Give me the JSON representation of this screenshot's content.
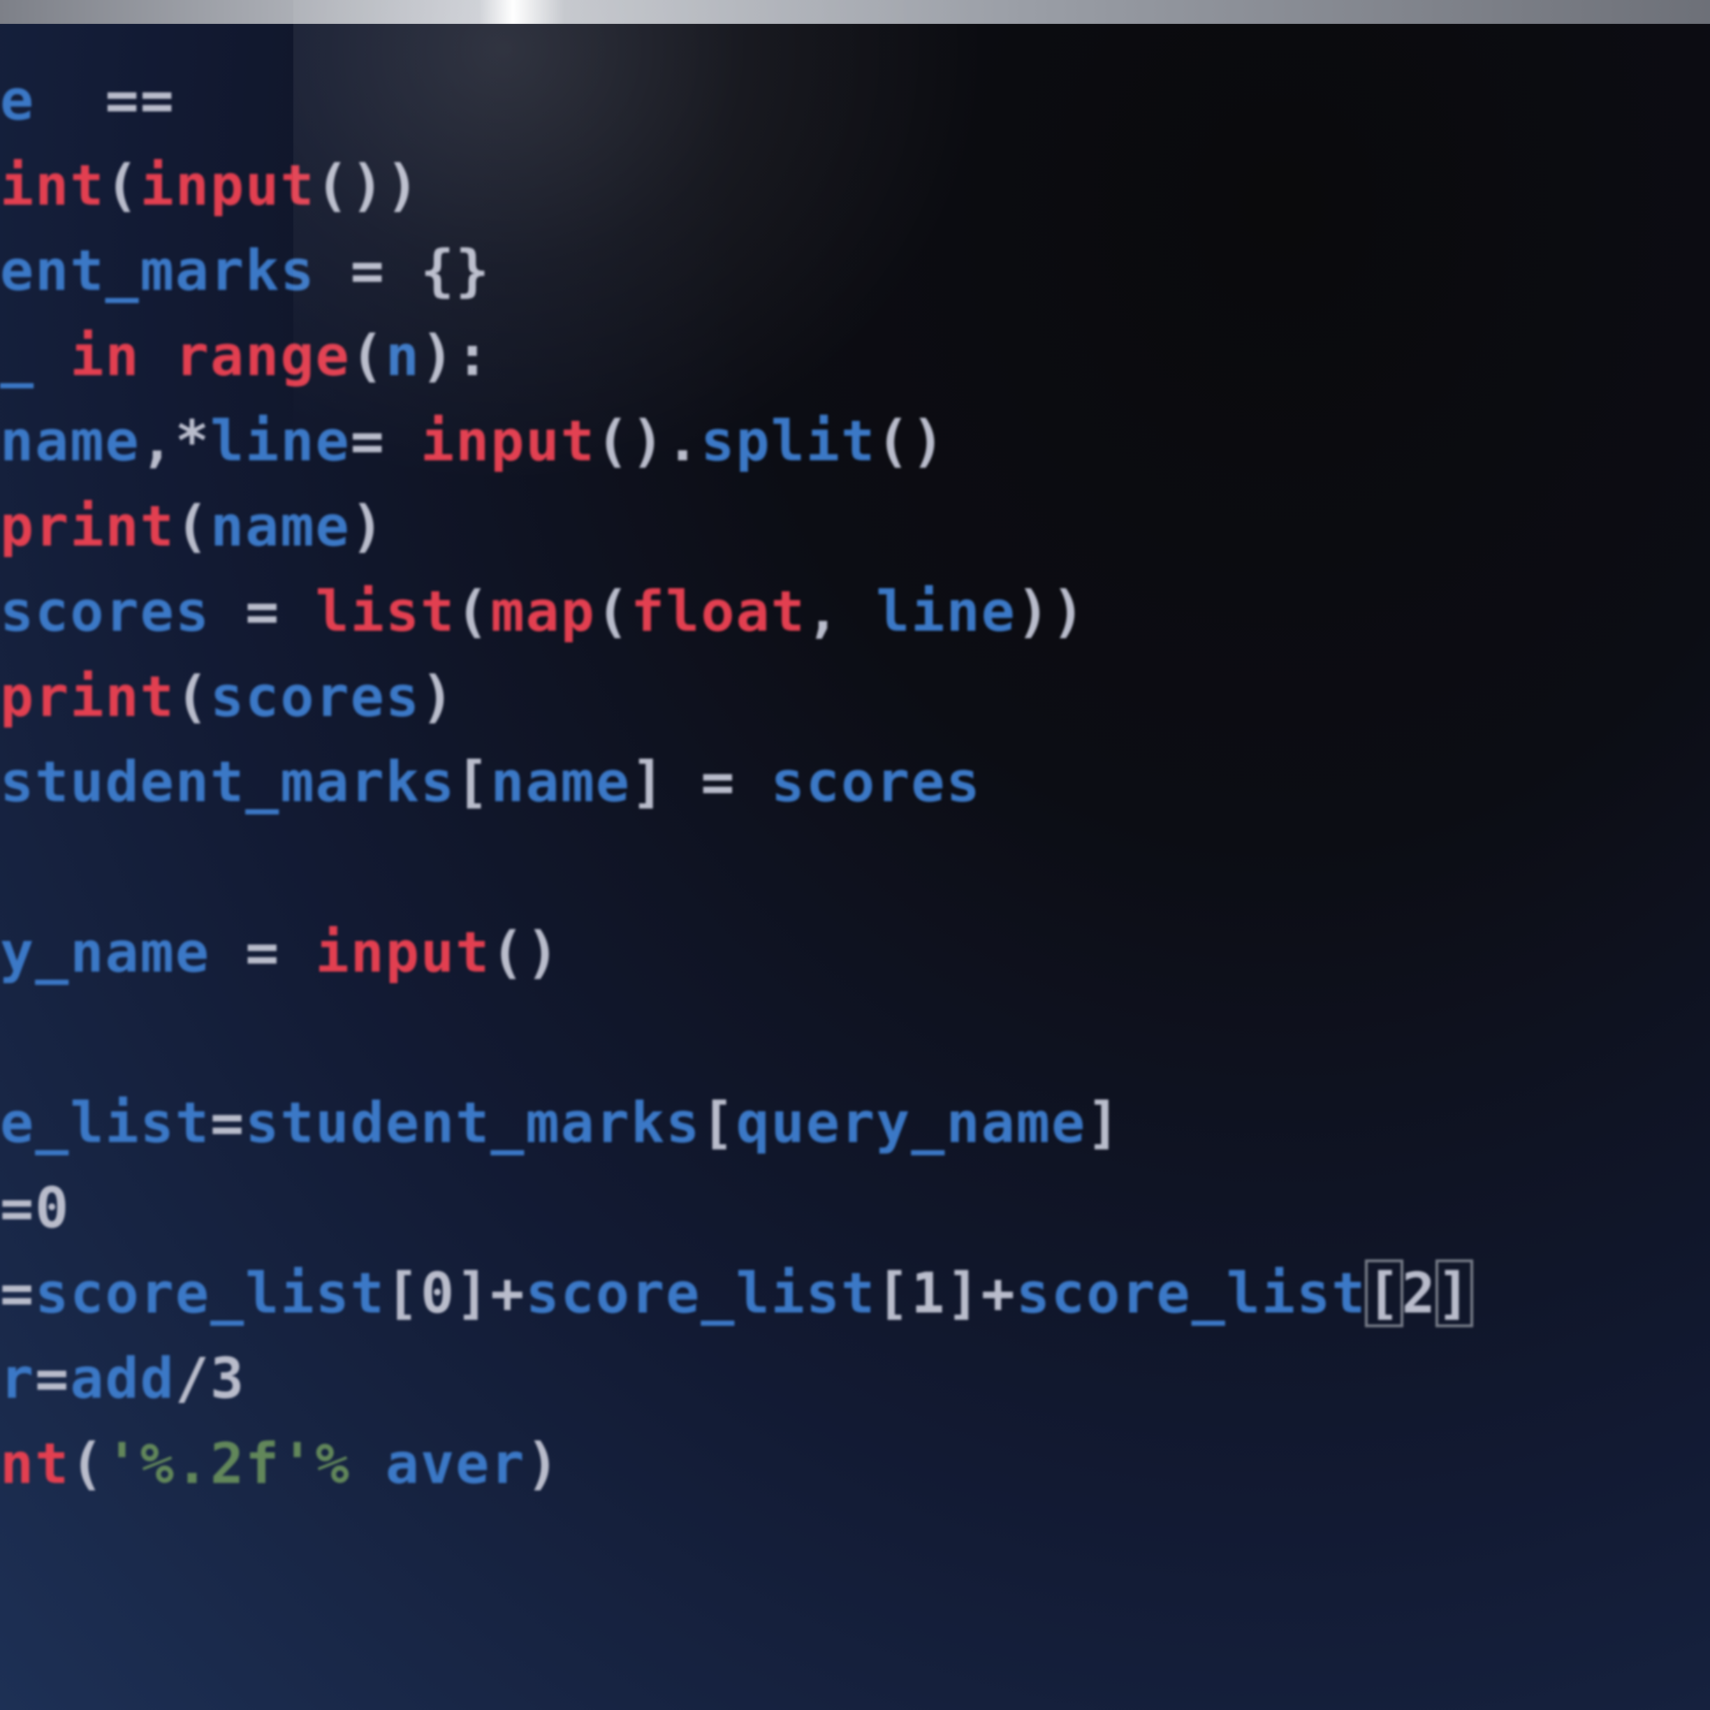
{
  "editor": {
    "lines": [
      {
        "tokens": [
          {
            "t": "e",
            "c": "id"
          },
          {
            "t": "  ==",
            "c": "pn"
          }
        ]
      },
      {
        "tokens": [
          {
            "t": "int",
            "c": "kw"
          },
          {
            "t": "(",
            "c": "pn"
          },
          {
            "t": "input",
            "c": "kw"
          },
          {
            "t": "())",
            "c": "pn"
          }
        ]
      },
      {
        "tokens": [
          {
            "t": "ent_marks",
            "c": "id"
          },
          {
            "t": " = {}",
            "c": "pn"
          }
        ]
      },
      {
        "tokens": [
          {
            "t": "_ ",
            "c": "id"
          },
          {
            "t": "in ",
            "c": "kw"
          },
          {
            "t": "range",
            "c": "kw"
          },
          {
            "t": "(",
            "c": "pn"
          },
          {
            "t": "n",
            "c": "id"
          },
          {
            "t": "):",
            "c": "pn"
          }
        ]
      },
      {
        "tokens": [
          {
            "t": "name",
            "c": "id"
          },
          {
            "t": ",*",
            "c": "pn"
          },
          {
            "t": "line",
            "c": "id"
          },
          {
            "t": "= ",
            "c": "pn"
          },
          {
            "t": "input",
            "c": "kw"
          },
          {
            "t": "().",
            "c": "pn"
          },
          {
            "t": "split",
            "c": "id"
          },
          {
            "t": "()",
            "c": "pn"
          }
        ]
      },
      {
        "tokens": [
          {
            "t": "print",
            "c": "kw"
          },
          {
            "t": "(",
            "c": "pn"
          },
          {
            "t": "name",
            "c": "id"
          },
          {
            "t": ")",
            "c": "pn"
          }
        ]
      },
      {
        "tokens": [
          {
            "t": "scores",
            "c": "id"
          },
          {
            "t": " = ",
            "c": "pn"
          },
          {
            "t": "list",
            "c": "kw"
          },
          {
            "t": "(",
            "c": "pn"
          },
          {
            "t": "map",
            "c": "kw"
          },
          {
            "t": "(",
            "c": "pn"
          },
          {
            "t": "float",
            "c": "kw"
          },
          {
            "t": ", ",
            "c": "pn"
          },
          {
            "t": "line",
            "c": "id"
          },
          {
            "t": "))",
            "c": "pn"
          }
        ]
      },
      {
        "tokens": [
          {
            "t": "print",
            "c": "kw"
          },
          {
            "t": "(",
            "c": "pn"
          },
          {
            "t": "scores",
            "c": "id"
          },
          {
            "t": ")",
            "c": "pn"
          }
        ]
      },
      {
        "tokens": [
          {
            "t": "student_marks",
            "c": "id"
          },
          {
            "t": "[",
            "c": "pn"
          },
          {
            "t": "name",
            "c": "id"
          },
          {
            "t": "] = ",
            "c": "pn"
          },
          {
            "t": "scores",
            "c": "id"
          }
        ]
      },
      {
        "tokens": []
      },
      {
        "tokens": [
          {
            "t": "y_name",
            "c": "id"
          },
          {
            "t": " = ",
            "c": "pn"
          },
          {
            "t": "input",
            "c": "kw"
          },
          {
            "t": "()",
            "c": "pn"
          }
        ]
      },
      {
        "tokens": []
      },
      {
        "tokens": [
          {
            "t": "e_list",
            "c": "id"
          },
          {
            "t": "=",
            "c": "pn"
          },
          {
            "t": "student_marks",
            "c": "id"
          },
          {
            "t": "[",
            "c": "pn"
          },
          {
            "t": "query_name",
            "c": "id"
          },
          {
            "t": "]",
            "c": "pn"
          }
        ]
      },
      {
        "tokens": [
          {
            "t": "=0",
            "c": "pn"
          }
        ]
      },
      {
        "tokens": [
          {
            "t": "=",
            "c": "pn"
          },
          {
            "t": "score_list",
            "c": "id"
          },
          {
            "t": "[0]+",
            "c": "pn"
          },
          {
            "t": "score_list",
            "c": "id"
          },
          {
            "t": "[1]+",
            "c": "pn"
          },
          {
            "t": "score_list",
            "c": "id"
          },
          {
            "t": "[",
            "c": "pn",
            "box": true
          },
          {
            "t": "2",
            "c": "pn"
          },
          {
            "t": "]",
            "c": "pn",
            "box": true
          }
        ]
      },
      {
        "tokens": [
          {
            "t": "r",
            "c": "id"
          },
          {
            "t": "=",
            "c": "pn"
          },
          {
            "t": "add",
            "c": "id"
          },
          {
            "t": "/3",
            "c": "pn"
          }
        ]
      },
      {
        "tokens": [
          {
            "t": "nt",
            "c": "kw"
          },
          {
            "t": "(",
            "c": "pn"
          },
          {
            "t": "'%.2f'%",
            "c": "str"
          },
          {
            "t": " ",
            "c": "pn"
          },
          {
            "t": "aver",
            "c": "id"
          },
          {
            "t": ")",
            "c": "pn"
          }
        ]
      }
    ]
  },
  "colors": {
    "keyword": "#e23f50",
    "identifier": "#3b78c6",
    "punctuation": "#b9bccb",
    "string": "#62875a"
  }
}
